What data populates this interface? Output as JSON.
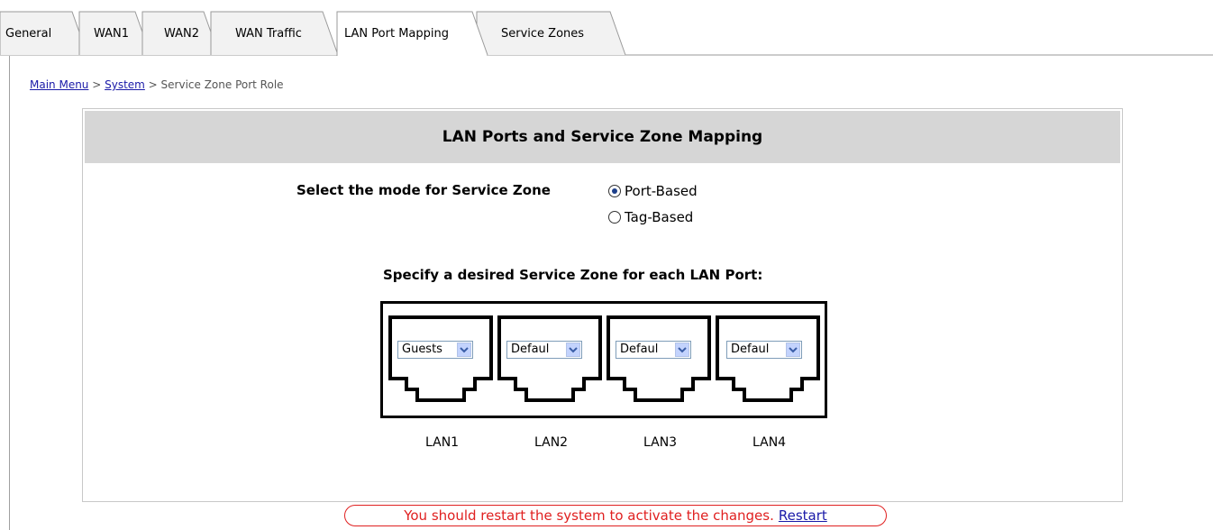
{
  "tabs": [
    {
      "label": "General"
    },
    {
      "label": "WAN1"
    },
    {
      "label": "WAN2"
    },
    {
      "label": "WAN Traffic"
    },
    {
      "label": "LAN Port Mapping"
    },
    {
      "label": "Service Zones"
    }
  ],
  "active_tab": "LAN Port Mapping",
  "breadcrumb": {
    "main_menu": "Main Menu",
    "sep1": " > ",
    "system": "System",
    "sep2": " > ",
    "current": "Service Zone Port Role"
  },
  "panel": {
    "title": "LAN Ports and Service Zone Mapping",
    "mode_label": "Select the mode for Service Zone",
    "mode_options": [
      {
        "label": "Port-Based",
        "selected": true
      },
      {
        "label": "Tag-Based",
        "selected": false
      }
    ],
    "specify_label": "Specify a desired Service Zone for each LAN Port:",
    "ports": [
      {
        "label": "LAN1",
        "zone": "Guests"
      },
      {
        "label": "LAN2",
        "zone": "Defaul"
      },
      {
        "label": "LAN3",
        "zone": "Defaul"
      },
      {
        "label": "LAN4",
        "zone": "Defaul"
      }
    ]
  },
  "notice": {
    "text": "You should restart the system to activate the changes.",
    "link": "Restart"
  },
  "colors": {
    "link": "#1a1aa8",
    "notice": "#e02020",
    "header_bg": "#d6d6d6"
  }
}
